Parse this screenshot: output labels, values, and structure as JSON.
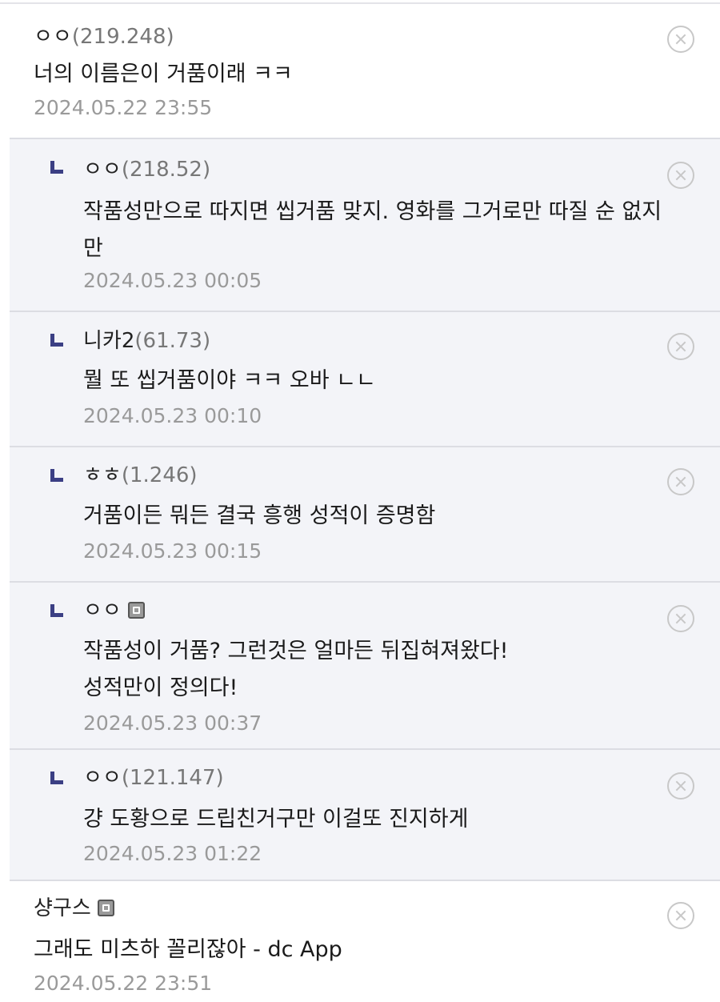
{
  "comments": [
    {
      "nick": "ㅇㅇ",
      "ip": "(219.248)",
      "text": "너의 이름은이 거품이래 ㅋㅋ",
      "time": "2024.05.22 23:55"
    },
    {
      "nick": "ㅇㅇ",
      "ip": "(218.52)",
      "text": "작품성만으로 따지면 씹거품 맞지. 영화를 그거로만 따질 순 없지\n만",
      "time": "2024.05.23 00:05"
    },
    {
      "nick": "니카2",
      "ip": "(61.73)",
      "text": "뭘 또 씹거품이야 ㅋㅋ 오바 ㄴㄴ",
      "time": "2024.05.23 00:10"
    },
    {
      "nick": "ㅎㅎ",
      "ip": "(1.246)",
      "text": "거품이든 뭐든 결국 흥행 성적이 증명함",
      "time": "2024.05.23 00:15"
    },
    {
      "nick": "ㅇㅇ",
      "ip": "",
      "text": "작품성이 거품? 그런것은 얼마든 뒤집혀져왔다!\n성적만이 정의다!",
      "time": "2024.05.23 00:37"
    },
    {
      "nick": "ㅇㅇ",
      "ip": "(121.147)",
      "text": "걍 도황으로 드립친거구만 이걸또 진지하게",
      "time": "2024.05.23 01:22"
    },
    {
      "nick": "샹구스",
      "ip": "",
      "text": "그래도 미츠하 꼴리잖아 - dc App",
      "time": "2024.05.22 23:51"
    }
  ],
  "colors": {
    "reply_bg": "#f3f4f8",
    "reply_mark": "#3b3f84",
    "timestamp": "#9a9a9a",
    "ip": "#777777"
  },
  "icons": {
    "delete": "close-circle-icon",
    "fixed_member": "fixed-nick-icon",
    "reply": "reply-arrow-icon"
  }
}
